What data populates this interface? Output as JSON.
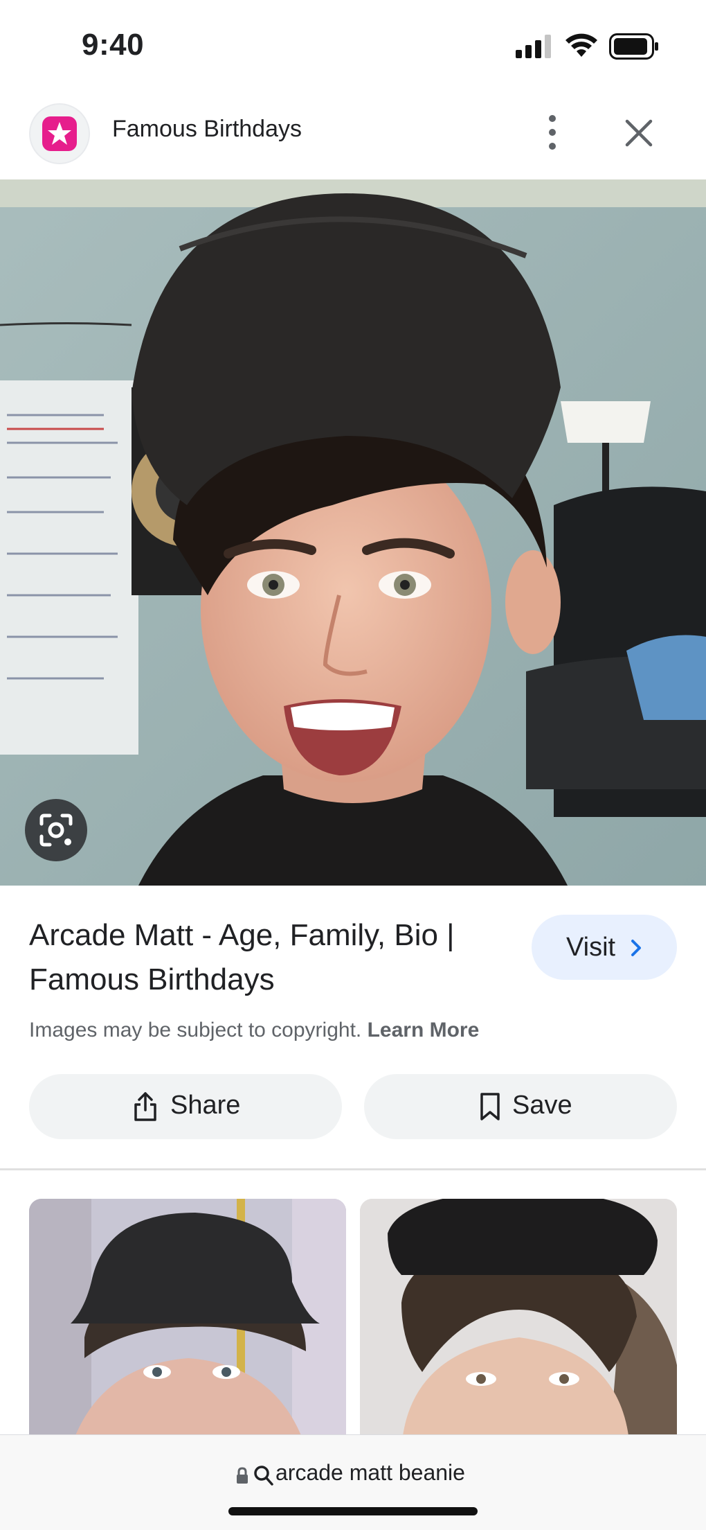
{
  "status_bar": {
    "time": "9:40"
  },
  "header": {
    "site_name": "Famous Birthdays"
  },
  "result": {
    "title": "Arcade Matt - Age, Family, Bio | Famous Birthdays",
    "visit_label": "Visit",
    "copyright_text": "Images may be subject to copyright.",
    "learn_more": "Learn More"
  },
  "actions": {
    "share_label": "Share",
    "save_label": "Save"
  },
  "address_bar": {
    "query": "arcade matt beanie"
  },
  "icons": {
    "site_logo": "star-logo-icon",
    "more": "more-vert-icon",
    "close": "close-icon",
    "lens": "lens-icon",
    "share": "share-icon",
    "save": "bookmark-icon",
    "lock": "lock-icon",
    "search": "search-icon"
  },
  "colors": {
    "brand_pink": "#e61e8c",
    "visit_bg": "#e8f0fe",
    "button_bg": "#f1f3f4",
    "link_blue": "#1a73e8"
  }
}
